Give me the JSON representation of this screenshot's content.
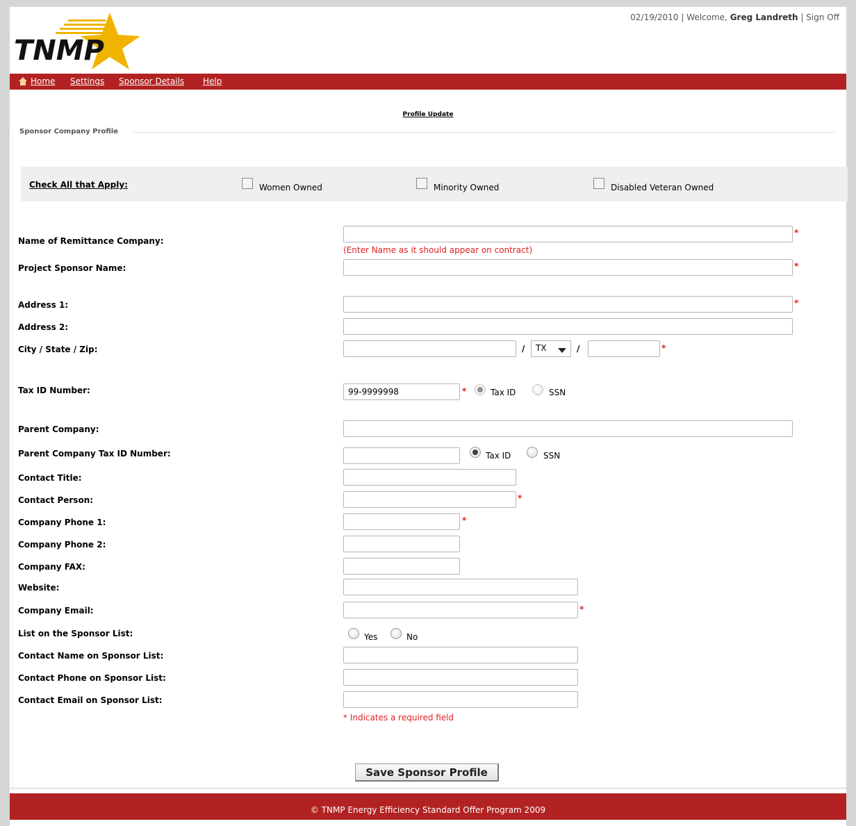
{
  "header": {
    "logo_text": "TNMP",
    "date": "02/19/2010",
    "welcome_prefix": "Welcome,",
    "user_name": "Greg Landreth",
    "sign_off": "Sign Off",
    "separator": "|"
  },
  "nav": {
    "items": [
      "Home",
      "Settings",
      "Sponsor Details",
      "Help"
    ]
  },
  "page": {
    "title": "Profile Update",
    "legend": "Sponsor Company Profile"
  },
  "ownership": {
    "title": "Check All that Apply:",
    "options": [
      "Women Owned",
      "Minority Owned",
      "Disabled Veteran Owned"
    ]
  },
  "form": {
    "remittance_company": {
      "label": "Name of Remittance Company:",
      "value": "",
      "hint": "(Enter Name as it should appear on contract)"
    },
    "project_sponsor_name": {
      "label": "Project Sponsor Name:",
      "value": ""
    },
    "address1": {
      "label": "Address 1:",
      "value": ""
    },
    "address2": {
      "label": "Address 2:",
      "value": ""
    },
    "city_state_zip": {
      "label": "City / State / Zip:",
      "city": "",
      "state": "TX",
      "zip": "",
      "slash": "/"
    },
    "tax_id": {
      "label": "Tax ID Number:",
      "value": "99-9999998",
      "option_tax": "Tax ID",
      "option_ssn": "SSN",
      "selected": "Tax ID"
    },
    "parent_company": {
      "label": "Parent Company:",
      "value": ""
    },
    "parent_tax_id": {
      "label": "Parent Company Tax ID Number:",
      "value": "",
      "option_tax": "Tax ID",
      "option_ssn": "SSN",
      "selected": "Tax ID"
    },
    "contact_title": {
      "label": "Contact Title:",
      "value": ""
    },
    "contact_person": {
      "label": "Contact Person:",
      "value": ""
    },
    "phone1": {
      "label": "Company Phone 1:",
      "value": ""
    },
    "phone2": {
      "label": "Company Phone 2:",
      "value": ""
    },
    "fax": {
      "label": "Company FAX:",
      "value": ""
    },
    "website": {
      "label": "Website:",
      "value": ""
    },
    "email": {
      "label": "Company Email:",
      "value": ""
    },
    "list_on_sponsor": {
      "label": "List on the Sponsor List:",
      "option_yes": "Yes",
      "option_no": "No"
    },
    "contact_name_list": {
      "label": "Contact Name on Sponsor List:",
      "value": ""
    },
    "contact_phone_list": {
      "label": "Contact Phone on Sponsor List:",
      "value": ""
    },
    "contact_email_list": {
      "label": "Contact Email on Sponsor List:",
      "value": ""
    },
    "required_marker": "*",
    "required_note": "* Indicates a required field"
  },
  "actions": {
    "save_label": "Save Sponsor Profile"
  },
  "footer": {
    "text": "© TNMP Energy Efficiency Standard Offer Program 2009"
  },
  "colors": {
    "brand_red": "#b22222",
    "required_red": "#e02020",
    "logo_gold": "#f0b400"
  }
}
